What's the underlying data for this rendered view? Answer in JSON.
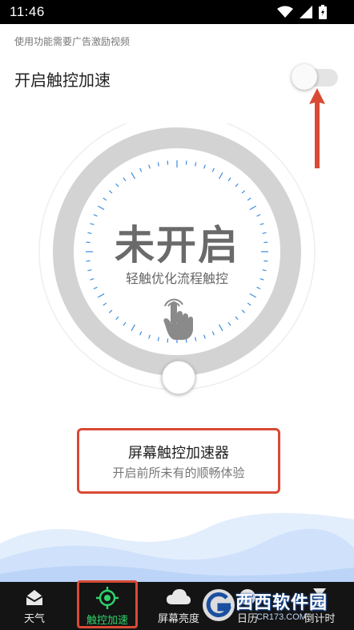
{
  "status_bar": {
    "time": "11:46"
  },
  "hint": "使用功能需要广告激励视频",
  "toggle": {
    "label": "开启触控加速",
    "state": "off"
  },
  "dial": {
    "status": "未开启",
    "subtitle": "轻触优化流程触控"
  },
  "feature_card": {
    "title": "屏幕触控加速器",
    "subtitle": "开启前所未有的顺畅体验"
  },
  "bottom_nav": {
    "items": [
      {
        "label": "天气",
        "icon": "weather-icon"
      },
      {
        "label": "触控加速",
        "icon": "touch-target-icon",
        "active": true
      },
      {
        "label": "屏幕亮度",
        "icon": "cloud-icon"
      },
      {
        "label": "日历",
        "icon": "calendar-icon"
      },
      {
        "label": "倒计时",
        "icon": "timer-icon"
      }
    ]
  },
  "watermark": {
    "brand": "西西软件园",
    "site": "CR173.COM"
  },
  "colors": {
    "accent_green": "#2fd36b",
    "annotation_red": "#d94a35",
    "ring_gray": "#d3d3d3",
    "tick_blue": "#3a8be0",
    "nav_background": "#141414"
  }
}
